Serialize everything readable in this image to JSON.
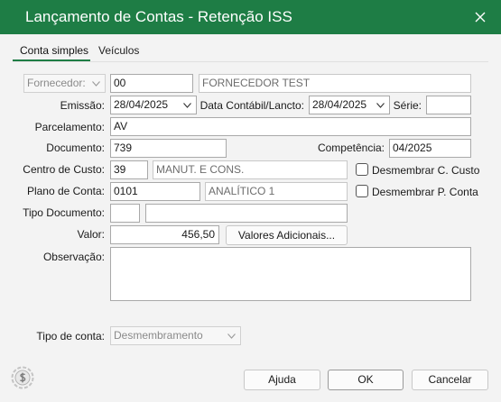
{
  "window": {
    "title": "Lançamento de Contas - Retenção ISS",
    "close_icon": "close-icon",
    "accent_color": "#1e7d45"
  },
  "tabs": [
    {
      "label": "Conta simples"
    },
    {
      "label": "Veículos"
    }
  ],
  "form": {
    "fornecedor": {
      "select_value": "Fornecedor:",
      "code": "00",
      "name": "FORNECEDOR TEST"
    },
    "emissao": {
      "label": "Emissão:",
      "value": "28/04/2025"
    },
    "data_contabil": {
      "label": "Data Contábil/Lancto:",
      "value": "28/04/2025"
    },
    "serie": {
      "label": "Série:",
      "value": ""
    },
    "parcelamento": {
      "label": "Parcelamento:",
      "value": "AV"
    },
    "documento": {
      "label": "Documento:",
      "value": "739"
    },
    "competencia": {
      "label": "Competência:",
      "value": "04/2025"
    },
    "centro_custo": {
      "label": "Centro de Custo:",
      "code": "39",
      "name": "MANUT. E CONS.",
      "checkbox_label": "Desmembrar C. Custo"
    },
    "plano_conta": {
      "label": "Plano de Conta:",
      "code": "0101",
      "name": "ANALÍTICO 1",
      "checkbox_label": "Desmembrar P. Conta"
    },
    "tipo_documento": {
      "label": "Tipo Documento:",
      "code": "",
      "name": ""
    },
    "valor": {
      "label": "Valor:",
      "value": "456,50",
      "button_label": "Valores Adicionais..."
    },
    "observacao": {
      "label": "Observação:",
      "value": ""
    },
    "tipo_conta": {
      "label": "Tipo de conta:",
      "value": "Desmembramento"
    }
  },
  "footer": {
    "logo_icon": "dollar-coin-icon",
    "help_label": "Ajuda",
    "ok_label": "OK",
    "cancel_label": "Cancelar"
  }
}
